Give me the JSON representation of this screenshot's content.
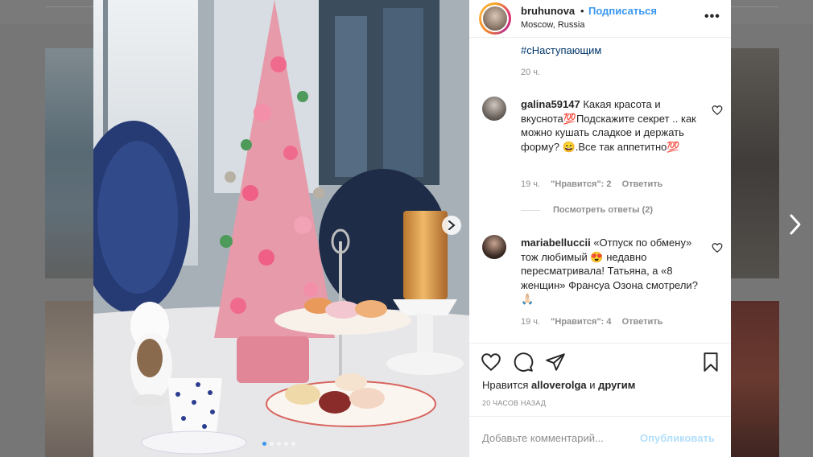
{
  "post": {
    "username": "bruhunova",
    "separator": "•",
    "follow_label": "Подписаться",
    "location": "Moscow, Russia",
    "more_label": "•••",
    "caption_hashtag": "#сНаступающим",
    "caption_time": "20 ч."
  },
  "comments": [
    {
      "username": "galina59147",
      "text": " Какая красота и вкуснота💯Подскажите секрет .. как можно кушать сладкое и держать форму? 😄.Все так аппетитно💯",
      "time": "19 ч.",
      "likes": "\"Нравится\": 2",
      "reply_label": "Ответить",
      "view_replies": "Посмотреть ответы (2)"
    },
    {
      "username": "mariabelluccii",
      "text": " «Отпуск по обмену» тож любимый 😍 недавно пересматривала! Татьяна, а «8 женщин» Франсуа Озона смотрели? 🙏🏻",
      "time": "19 ч.",
      "likes": "\"Нравится\": 4",
      "reply_label": "Ответить"
    }
  ],
  "likes_summary": {
    "prefix": "Нравится ",
    "user": "alloverolga",
    "middle": " и ",
    "others": "другим"
  },
  "post_time": "20 ЧАСОВ НАЗАД",
  "comment_box": {
    "placeholder": "Добавьте комментарий...",
    "publish_label": "Опубликовать"
  },
  "carousel": {
    "total": 5,
    "current": 1
  },
  "colors": {
    "link_blue": "#3897f0",
    "hashtag": "#003569",
    "muted": "#8e8e8e",
    "text": "#262626",
    "publish_disabled": "#b2dffc"
  },
  "icons": [
    "heart-icon",
    "comment-icon",
    "share-icon",
    "bookmark-icon",
    "chevron-right-icon",
    "more-icon"
  ]
}
